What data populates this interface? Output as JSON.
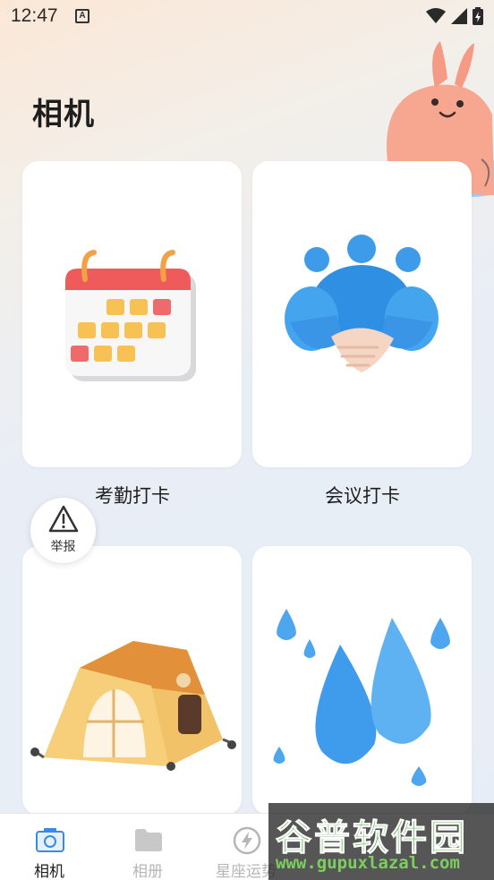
{
  "status_bar": {
    "time": "12:47",
    "notification_icon": "A"
  },
  "header": {
    "title": "相机"
  },
  "cards": [
    {
      "label": "考勤打卡",
      "icon": "calendar-3d-icon"
    },
    {
      "label": "会议打卡",
      "icon": "handshake-3d-icon"
    },
    {
      "label": "",
      "icon": "tent-3d-icon"
    },
    {
      "label": "",
      "icon": "water-drops-3d-icon"
    }
  ],
  "report": {
    "label": "举报",
    "icon": "warning-triangle-icon"
  },
  "bottom_nav": {
    "items": [
      {
        "label": "相机",
        "icon": "camera-icon",
        "active": true
      },
      {
        "label": "相册",
        "icon": "folder-icon",
        "active": false
      },
      {
        "label": "星座运势",
        "icon": "lightning-icon",
        "active": false
      }
    ]
  },
  "watermark": {
    "title": "谷普软件园",
    "url": "www.gupuxlazal.com"
  },
  "colors": {
    "accent": "#3a8be0",
    "inactive": "#b6b6b6",
    "card_bg": "#ffffff"
  }
}
